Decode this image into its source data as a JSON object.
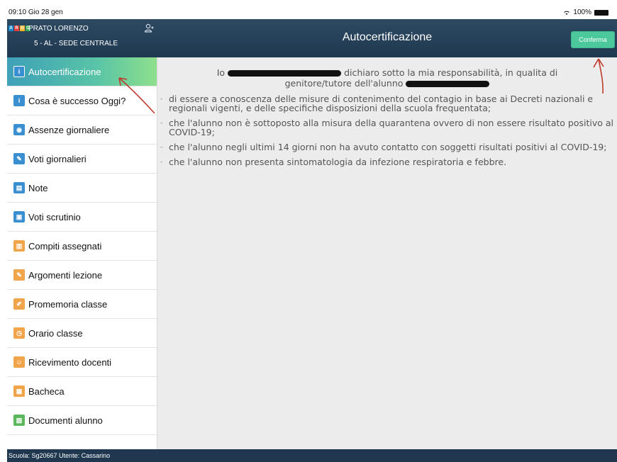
{
  "status_bar": {
    "time": "09:10",
    "date": "Gio 28 gen",
    "battery": "100%"
  },
  "header": {
    "logo": [
      "A",
      "R",
      "G",
      "O"
    ],
    "student_name": "PRATO LORENZO",
    "student_class": "5 - AL - SEDE CENTRALE",
    "title": "Autocertificazione",
    "confirm_label": "Conferma"
  },
  "sidebar": {
    "items": [
      {
        "label": "Autocertificazione",
        "icon": "info-icon",
        "color": "#3a8fd0",
        "active": true
      },
      {
        "label": "Cosa è successo Oggi?",
        "icon": "info-icon",
        "color": "#3a8fd0",
        "active": false
      },
      {
        "label": "Assenze giornaliere",
        "icon": "calendar-absence-icon",
        "color": "#3a8fd0",
        "active": false
      },
      {
        "label": "Voti giornalieri",
        "icon": "grades-icon",
        "color": "#3a8fd0",
        "active": false
      },
      {
        "label": "Note",
        "icon": "notes-icon",
        "color": "#3a8fd0",
        "active": false
      },
      {
        "label": "Voti scrutinio",
        "icon": "report-card-icon",
        "color": "#3a8fd0",
        "active": false
      },
      {
        "label": "Compiti assegnati",
        "icon": "homework-icon",
        "color": "#f0a54a",
        "active": false
      },
      {
        "label": "Argomenti lezione",
        "icon": "lesson-topics-icon",
        "color": "#f0a54a",
        "active": false
      },
      {
        "label": "Promemoria classe",
        "icon": "reminder-icon",
        "color": "#f0a54a",
        "active": false
      },
      {
        "label": "Orario classe",
        "icon": "timetable-icon",
        "color": "#f0a54a",
        "active": false
      },
      {
        "label": "Ricevimento docenti",
        "icon": "teacher-meeting-icon",
        "color": "#f0a54a",
        "active": false
      },
      {
        "label": "Bacheca",
        "icon": "noticeboard-icon",
        "color": "#f0a54a",
        "active": false
      },
      {
        "label": "Documenti alunno",
        "icon": "documents-icon",
        "color": "#5cb85c",
        "active": false
      }
    ]
  },
  "content": {
    "intro_prefix": "Io",
    "intro_middle": "dichiaro sotto la mia responsabilità, in qualita di",
    "intro_line2": "genitore/tutore dell'alunno",
    "clauses": [
      "di essere a conoscenza delle misure di contenimento del contagio in base ai Decreti nazionali e regionali vigenti, e delle specifiche disposizioni della scuola frequentata;",
      "che l'alunno non è sottoposto alla misura della quarantena ovvero di non essere risultato positivo al COVID-19;",
      "che l'alunno negli ultimi 14 giorni non ha avuto contatto con soggetti risultati positivi al COVID-19;",
      "che l'alunno non presenta sintomatologia da infezione respiratoria e febbre."
    ]
  },
  "footer": {
    "text": "Scuola: Sg20667 Utente: Cassarino"
  },
  "colors": {
    "header_bg": "#1f384f",
    "accent": "#4cc99c",
    "content_bg": "#ececec",
    "annotation": "#c0392b"
  }
}
